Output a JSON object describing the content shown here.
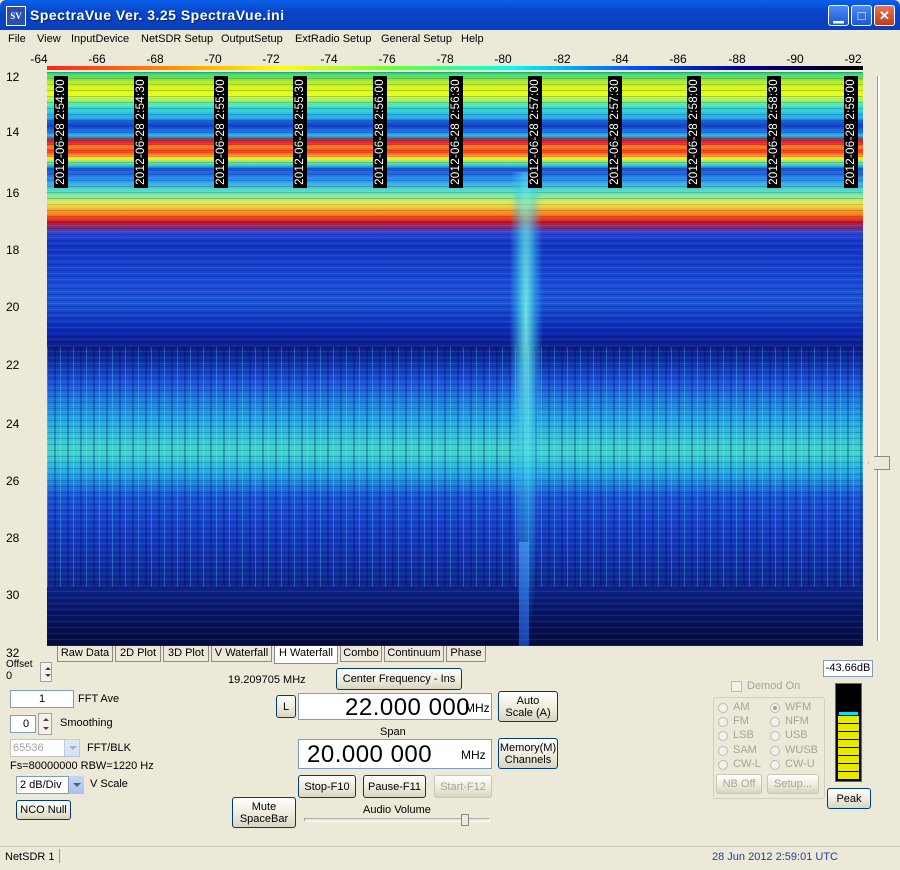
{
  "window": {
    "title": "SpectraVue Ver. 3.25  SpectraVue.ini",
    "icon_text": "SV",
    "minimize_icon": "minimize-icon",
    "maximize_icon": "maximize-icon",
    "close_icon": "close-icon"
  },
  "menu": [
    "File",
    "View",
    "InputDevice",
    "NetSDR Setup",
    "OutputSetup",
    "ExtRadio Setup",
    "General Setup",
    "Help"
  ],
  "scale": {
    "ticks": [
      "-64",
      "-66",
      "-68",
      "-70",
      "-72",
      "-74",
      "-76",
      "-78",
      "-80",
      "-82",
      "-84",
      "-86",
      "-88",
      "-90",
      "-92"
    ]
  },
  "y_axis": {
    "ticks": [
      "12",
      "14",
      "16",
      "18",
      "20",
      "22",
      "24",
      "26",
      "28",
      "30",
      "32"
    ]
  },
  "waterfall": {
    "timestamps": [
      "2012-06-28 2:54:00",
      "2012-06-28 2:54:30",
      "2012-06-28 2:55:00",
      "2012-06-28 2:55:30",
      "2012-06-28 2:56:00",
      "2012-06-28 2:56:30",
      "2012-06-28 2:57:00",
      "2012-06-28 2:57:30",
      "2012-06-28 2:58:00",
      "2012-06-28 2:58:30",
      "2012-06-28 2:59:00"
    ]
  },
  "tabs": [
    "Raw Data",
    "2D Plot",
    "3D Plot",
    "V Waterfall",
    "H Waterfall",
    "Combo",
    "Continuum",
    "Phase"
  ],
  "active_tab": "H Waterfall",
  "controls": {
    "offset_label": "Offset",
    "offset_value": "0",
    "fft_ave_value": "1",
    "fft_ave_label": "FFT Ave",
    "smoothing_value": "0",
    "smoothing_label": "Smoothing",
    "fft_blk_value": "65536",
    "fft_blk_label": "FFT/BLK",
    "fs_info": "Fs=80000000 RBW=1220 Hz",
    "vscale_value": "2 dB/Div",
    "vscale_label": "V Scale",
    "nco_null": "NCO Null",
    "cursor_freq": "19.209705 MHz",
    "center_freq_button": "Center Frequency - Ins",
    "l_button": "L",
    "center_freq_value": "22.000 000",
    "center_freq_unit": "MHz",
    "span_label": "Span",
    "span_value": "20.000 000",
    "span_unit": "MHz",
    "auto_scale": "Auto Scale (A)",
    "memory_channels": "Memory(M) Channels",
    "stop": "Stop-F10",
    "pause": "Pause-F11",
    "start": "Start-F12",
    "mute": "Mute SpaceBar",
    "audio_volume_label": "Audio Volume",
    "audio_volume_level": 0.88
  },
  "demod": {
    "demod_on_label": "Demod On",
    "modes_left": [
      "AM",
      "FM",
      "LSB",
      "SAM",
      "CW-L"
    ],
    "modes_right": [
      "WFM",
      "NFM",
      "USB",
      "WUSB",
      "CW-U"
    ],
    "selected": "WFM",
    "nb_off": "NB Off",
    "setup": "Setup..."
  },
  "meter": {
    "level_label": "-43.66dB",
    "peak_button": "Peak",
    "fill_fraction": 0.66,
    "peak_fraction": 0.68
  },
  "status": {
    "device": "NetSDR 1",
    "datetime": "28 Jun 2012  2:59:01 UTC"
  },
  "colors": {
    "status_datetime": "#1F3FA8"
  }
}
